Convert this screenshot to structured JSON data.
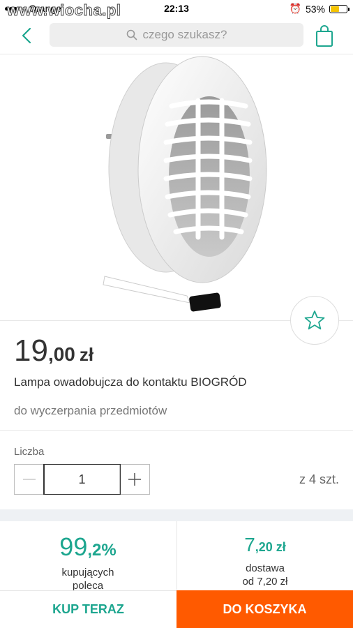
{
  "status_bar": {
    "carrier": "Orange",
    "time": "22:13",
    "battery": "53%",
    "battery_level": 0.53,
    "watermark": "www.wiocha.pl"
  },
  "nav": {
    "search_placeholder": "czego szukasz?",
    "accent_color": "#1da68f"
  },
  "product": {
    "price_int": "19",
    "price_dec": ",00",
    "currency": "zł",
    "title": "Lampa owadobujcza do kontaktu BIOGRÓD",
    "availability": "do wyczerpania przedmiotów"
  },
  "quantity": {
    "label": "Liczba",
    "value": "1",
    "stock": "z 4 szt."
  },
  "seller": {
    "rating_int": "99",
    "rating_dec": ",2%",
    "rating_label_1": "kupujących",
    "rating_label_2": "poleca"
  },
  "shipping": {
    "price_int": "7",
    "price_dec": ",20 zł",
    "label_1": "dostawa",
    "label_2": "od 7,20 zł"
  },
  "actions": {
    "buy_now": "KUP TERAZ",
    "add_to_cart": "DO KOSZYKA",
    "cart_color": "#ff5a00"
  }
}
